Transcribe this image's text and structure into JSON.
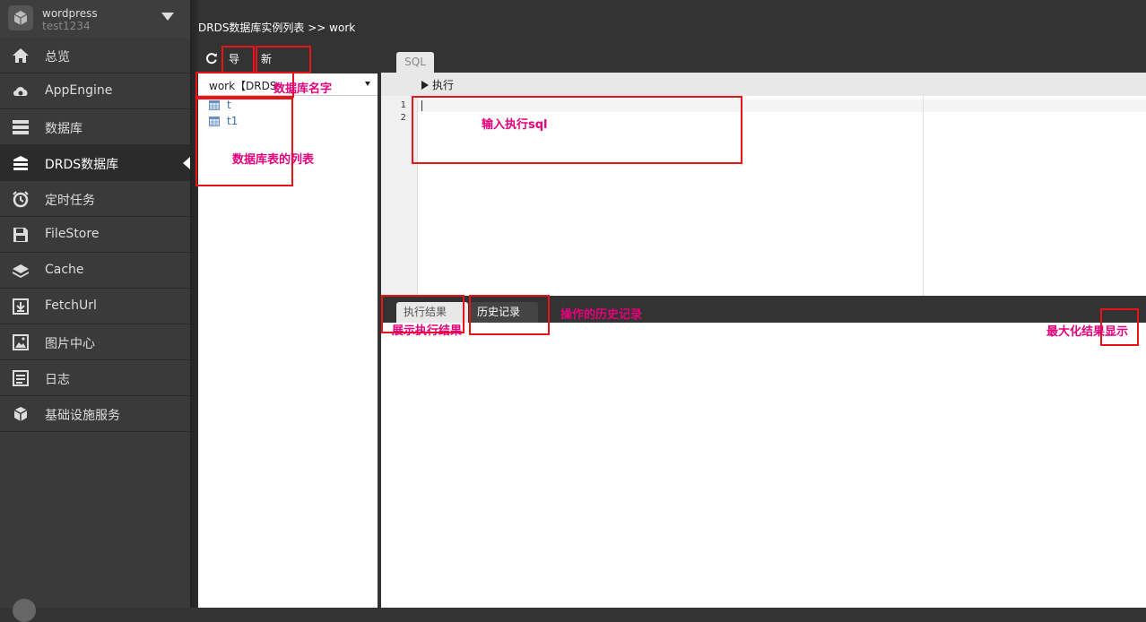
{
  "app": {
    "name": "wordpress",
    "user": "test1234"
  },
  "nav": [
    {
      "label": "总览",
      "icon": "home-icon"
    },
    {
      "label": "AppEngine",
      "icon": "cloud-gear-icon"
    },
    {
      "label": "数据库",
      "icon": "database-icon"
    },
    {
      "label": "DRDS数据库",
      "icon": "drds-database-icon",
      "active": true
    },
    {
      "label": "定时任务",
      "icon": "alarm-clock-icon"
    },
    {
      "label": "FileStore",
      "icon": "save-disk-icon"
    },
    {
      "label": "Cache",
      "icon": "cache-layers-icon"
    },
    {
      "label": "FetchUrl",
      "icon": "download-icon"
    },
    {
      "label": "图片中心",
      "icon": "image-center-icon"
    },
    {
      "label": "日志",
      "icon": "log-list-icon"
    },
    {
      "label": "基础设施服务",
      "icon": "cubes-icon"
    }
  ],
  "breadcrumb": "DRDS数据库实例列表 >> work",
  "toolbar": {
    "import_label": "导入",
    "new_table_label": "新建表"
  },
  "db_select": {
    "value": "work【DRDS"
  },
  "tables": [
    "t",
    "t1"
  ],
  "sql_tab": "SQL",
  "exec_label": "执行",
  "line_numbers": [
    "1",
    "2"
  ],
  "result_tabs": {
    "exec_result": "执行结果",
    "history": "历史记录"
  },
  "annotations": {
    "db_name": "数据库名字",
    "table_list": "数据库表的列表",
    "input_sql": "输入执行sql",
    "history": "操作的历史记录",
    "show_result": "展示执行结果",
    "maximize": "最大化结果显示"
  },
  "colors": {
    "annotation_text": "#e3007a",
    "annotation_box": "#e8141a",
    "table_link": "#3a6ea5"
  }
}
